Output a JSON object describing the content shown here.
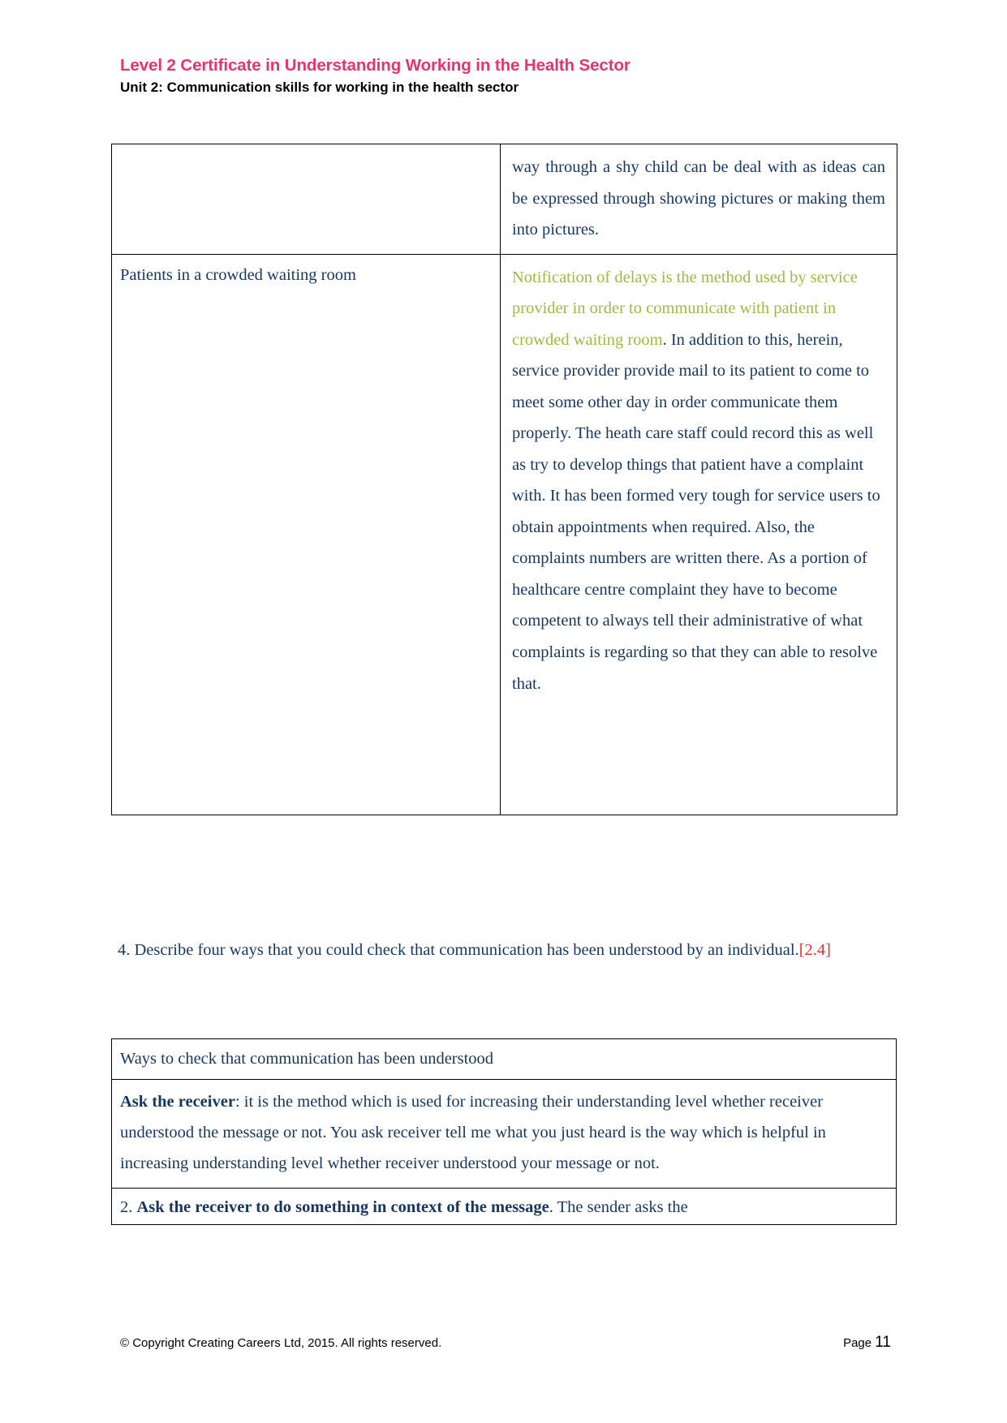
{
  "header": {
    "title": "Level 2 Certificate in Understanding Working in the Health Sector",
    "subtitle": "Unit 2: Communication skills for working in the health sector",
    "title_color": "#E8336D"
  },
  "table_one": {
    "row1": {
      "left": "",
      "right_magenta": "way through a shy child can be deal with  as ideas can be expressed through showing pictures or making them into pictures."
    },
    "row2": {
      "left": "Patients in a crowded waiting room",
      "right_green": "Notification of delays is the method used by service provider in order to communicate with patient in crowded waiting room",
      "right_navy": ". In addition to this, herein, service provider provide mail to its patient to come to meet some other day in order communicate them properly. The heath care staff could record this as well as try to develop things that patient have a complaint with. It has been formed very tough for service users to obtain appointments when required. Also, the complaints numbers are written there. As a portion of healthcare centre complaint they have to become competent to always tell their administrative of what complaints is regarding so that they can able to resolve that."
    },
    "colors": {
      "magenta": "#CC0FCC",
      "green": "#9BBB42",
      "navy": "#17365D"
    }
  },
  "question": {
    "text": "4. Describe four ways that you could check that communication has been understood by an individual.",
    "reference": "[2.4]",
    "reference_color": "#E03030"
  },
  "table_two": {
    "header": "Ways to check that communication has been understood",
    "row1_bold": "Ask the receiver",
    "row1_text": ":  it is the method which is used for increasing their understanding level whether receiver understood the message or not. You ask receiver tell me what you just heard is the way which is helpful in increasing understanding level whether receiver understood your message or not.",
    "row2_number": "2. ",
    "row2_bold": "Ask the receiver to do something in context of the message",
    "row2_text": ". The sender asks the"
  },
  "footer": {
    "copyright": "© Copyright Creating Careers Ltd, 2015. All rights reserved.",
    "page_label": "Page ",
    "page_number": "11"
  }
}
